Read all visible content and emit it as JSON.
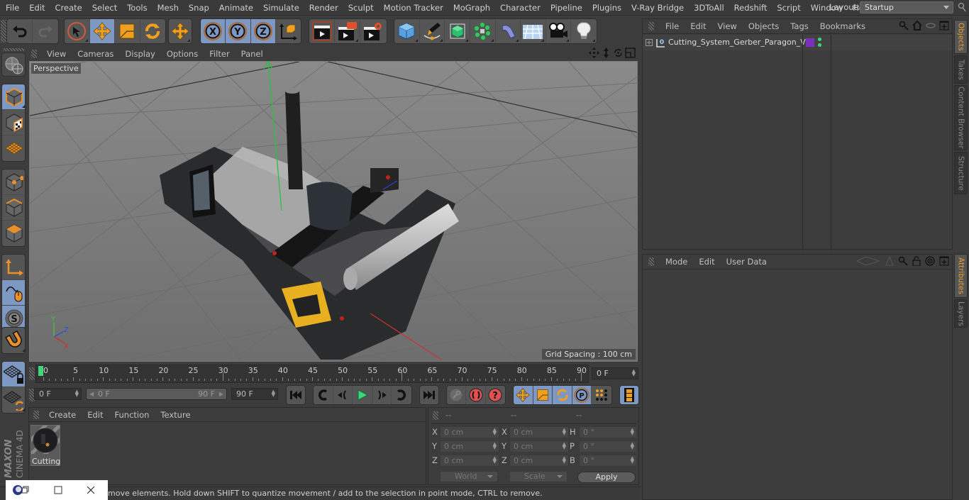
{
  "menubar": {
    "items": [
      "File",
      "Edit",
      "Create",
      "Select",
      "Tools",
      "Mesh",
      "Snap",
      "Animate",
      "Simulate",
      "Render",
      "Sculpt",
      "Motion Tracker",
      "MoGraph",
      "Character",
      "Pipeline",
      "Plugins",
      "V-Ray Bridge",
      "3DToAll",
      "Redshift",
      "Script",
      "Window",
      "Help"
    ],
    "layout_label": "Layout:",
    "layout_value": "Startup"
  },
  "toolbar": {
    "history": [
      "undo-icon",
      "redo-icon"
    ],
    "modes": [
      "live-selection-icon",
      "move-icon",
      "scale-icon",
      "rotate-icon"
    ],
    "last_tool": "move-icon",
    "axes": [
      "X",
      "Y",
      "Z"
    ],
    "coord_system": "world-coordinates-icon",
    "render": [
      "render-view-icon",
      "render-picture-viewer-icon",
      "render-settings-icon"
    ],
    "objects": [
      "cube-icon",
      "pen-spline-icon",
      "subdivision-surface-icon",
      "cloner-icon",
      "bend-deformer-icon",
      "floor-icon",
      "camera-icon",
      "light-icon"
    ]
  },
  "left_tools": [
    "model-mode-icon",
    "texture-mode-icon",
    "workplane-mode-icon",
    "points-mode-icon",
    "edges-mode-icon",
    "polygons-mode-icon",
    "axis-mode-icon",
    "tweak-mode-icon",
    "solo-icon",
    "snap-icon",
    "workplane-lock-icon",
    "workplane-align-icon"
  ],
  "viewport": {
    "menu": [
      "View",
      "Cameras",
      "Display",
      "Options",
      "Filter",
      "Panel"
    ],
    "camera_label": "Perspective",
    "grid_spacing": "Grid Spacing : 100 cm",
    "axis_labels": {
      "x": "X",
      "y": "Y",
      "z": "Z"
    }
  },
  "timeline": {
    "ticks": [
      "0",
      "5",
      "10",
      "15",
      "20",
      "25",
      "30",
      "35",
      "40",
      "45",
      "50",
      "55",
      "60",
      "65",
      "70",
      "75",
      "80",
      "85",
      "90"
    ],
    "current_frame": "0 F",
    "playhead_frame": 0,
    "min_frame": 0,
    "max_frame": 90
  },
  "transport": {
    "start_field": "0 F",
    "range_start": "0 F",
    "range_end": "90 F",
    "end_field": "90 F"
  },
  "material_panel": {
    "menu": [
      "Create",
      "Edit",
      "Function",
      "Texture"
    ],
    "materials": [
      {
        "name": "Cutting"
      }
    ]
  },
  "coord_panel": {
    "headers": [
      "--",
      "--",
      "--"
    ],
    "rows": [
      {
        "l1": "X",
        "v1": "0 cm",
        "l2": "X",
        "v2": "0 cm",
        "l3": "H",
        "v3": "0 °"
      },
      {
        "l1": "Y",
        "v1": "0 cm",
        "l2": "Y",
        "v2": "0 cm",
        "l3": "P",
        "v3": "0 °"
      },
      {
        "l1": "Z",
        "v1": "0 cm",
        "l2": "Z",
        "v2": "0 cm",
        "l3": "B",
        "v3": "0 °"
      }
    ],
    "coord_mode": "World",
    "size_mode": "Scale",
    "apply_label": "Apply"
  },
  "status": {
    "text": "move elements. Hold down SHIFT to quantize movement / add to the selection in point mode, CTRL to remove."
  },
  "objects_panel": {
    "menu": [
      "File",
      "Edit",
      "View",
      "Objects",
      "Tags",
      "Bookmarks"
    ],
    "objects": [
      {
        "name": "Cutting_System_Gerber_Paragon_VX",
        "layer_color": "#7b2fbe"
      }
    ]
  },
  "attributes_panel": {
    "menu": [
      "Mode",
      "Edit",
      "User Data"
    ]
  },
  "side_tabs_top": [
    {
      "label": "Objects",
      "active": true
    },
    {
      "label": "Takes",
      "active": false
    },
    {
      "label": "Content Browser",
      "active": false
    },
    {
      "label": "Structure",
      "active": false
    }
  ],
  "side_tabs_bottom": [
    {
      "label": "Attributes",
      "active": true
    },
    {
      "label": "Layers",
      "active": false
    }
  ],
  "brand": {
    "line1": "MAXON",
    "line2": "CINEMA 4D"
  },
  "colors": {
    "accent": "#e8a030",
    "active_button": "#7d98c2",
    "playhead": "#3ed67a"
  }
}
